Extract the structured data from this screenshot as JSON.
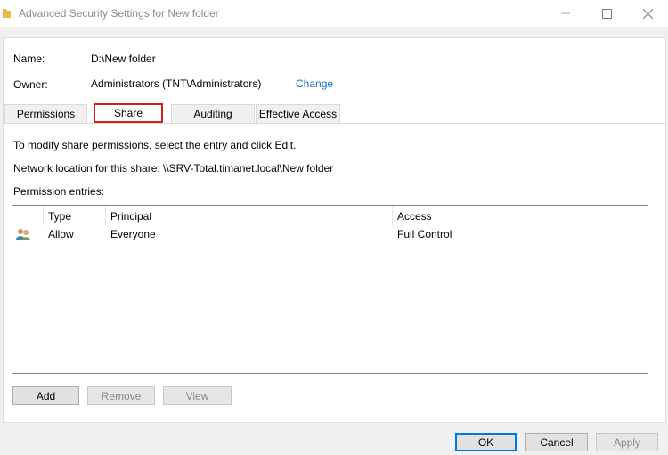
{
  "window": {
    "title": "Advanced Security Settings for New folder"
  },
  "info": {
    "name_label": "Name:",
    "name_value": "D:\\New folder",
    "owner_label": "Owner:",
    "owner_value": "Administrators (TNT\\Administrators)",
    "change_link": "Change"
  },
  "tabs": [
    {
      "label": "Permissions"
    },
    {
      "label": "Share"
    },
    {
      "label": "Auditing"
    },
    {
      "label": "Effective Access"
    }
  ],
  "share": {
    "instructions": "To modify share permissions, select the entry and click Edit.",
    "network_label": "Network location for this share:",
    "network_value": "\\\\SRV-Total.timanet.local\\New folder",
    "entries_label": "Permission entries:"
  },
  "table": {
    "columns": [
      "Type",
      "Principal",
      "Access"
    ],
    "rows": [
      {
        "type": "Allow",
        "principal": "Everyone",
        "access": "Full Control",
        "icon": "users-icon"
      }
    ]
  },
  "buttons": {
    "add": "Add",
    "remove": "Remove",
    "view": "View",
    "ok": "OK",
    "cancel": "Cancel",
    "apply": "Apply"
  },
  "colors": {
    "accent": "#0078d7",
    "highlight": "#d11f1f",
    "link": "#1a6fc4"
  }
}
